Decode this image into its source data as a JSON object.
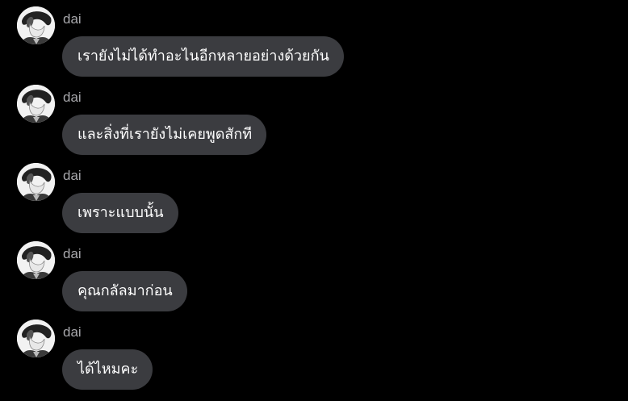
{
  "messages": [
    {
      "sender": "dai",
      "text": "เรายังไม่ได้ทำอะไนอีกหลายอย่างด้วยกัน",
      "avatar_icon": "avatar-icon"
    },
    {
      "sender": "dai",
      "text": "และสิ่งที่เรายังไม่เคยพูดสักที",
      "avatar_icon": "avatar-icon"
    },
    {
      "sender": "dai",
      "text": "เพราะแบบนั้น",
      "avatar_icon": "avatar-icon"
    },
    {
      "sender": "dai",
      "text": "คุณกลัลมาก่อน",
      "avatar_icon": "avatar-icon"
    },
    {
      "sender": "dai",
      "text": "ได้ไหมคะ",
      "avatar_icon": "avatar-icon"
    }
  ],
  "colors": {
    "background": "#000000",
    "bubble": "#3b3c40",
    "bubble_text": "#ffffff",
    "sender_name": "#a7a7ab"
  }
}
